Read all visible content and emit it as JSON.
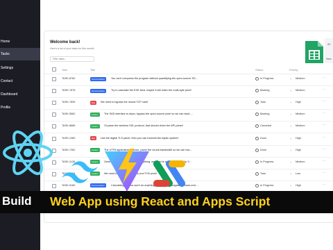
{
  "sidebar": {
    "items": [
      {
        "label": "Home"
      },
      {
        "label": "Tasks"
      },
      {
        "label": "Settings"
      },
      {
        "label": "Contact"
      },
      {
        "label": "Dashboard"
      },
      {
        "label": "Profile"
      }
    ],
    "active_index": 1
  },
  "header": {
    "title": "Welcome back!",
    "subtitle": "Here's a list of your tasks for this month!"
  },
  "filter": {
    "placeholder": "Filter tasks..."
  },
  "table": {
    "columns": [
      "Task",
      "Title",
      "Status",
      "Priority"
    ],
    "rows": [
      {
        "task": "TASK-8782",
        "label": "Documentation",
        "title": "You can't compress the program without quantifying the open-source SS...",
        "status": "In Progress",
        "priority": "Medium"
      },
      {
        "task": "TASK-7878",
        "label": "Documentation",
        "title": "Try to calculate the EXE feed, maybe it will index the multi-byte pixel!",
        "status": "Backlog",
        "priority": "Medium"
      },
      {
        "task": "TASK-7839",
        "label": "Bug",
        "title": "We need to bypass the neural TCP card!",
        "status": "Todo",
        "priority": "High"
      },
      {
        "task": "TASK-5562",
        "label": "Feature",
        "title": "The SAS interface is down, bypass the open-source pixel so we can back ...",
        "status": "Backlog",
        "priority": "Medium"
      },
      {
        "task": "TASK-8686",
        "label": "Feature",
        "title": "I'll parse the wireless SSL protocol, that should driver the API panel!",
        "status": "Canceled",
        "priority": "Medium"
      },
      {
        "task": "TASK-1280",
        "label": "Bug",
        "title": "Use the digital TLS panel, then you can transmit the haptic system!",
        "status": "Done",
        "priority": "High"
      },
      {
        "task": "TASK-7262",
        "label": "Feature",
        "title": "The UTF8 application is down, parse the neural bandwidth so we can bac...",
        "status": "Done",
        "priority": "High"
      },
      {
        "task": "TASK-1138",
        "label": "Feature",
        "title": "Generating the driver won't do anything, we need to quantify the 1080p S...",
        "status": "In Progress",
        "priority": "Medium"
      },
      {
        "task": "TASK-7184",
        "label": "Feature",
        "title": "We need to program the back-end THX pixel!",
        "status": "Todo",
        "priority": "Low"
      },
      {
        "task": "TASK-5160",
        "label": "Documentation",
        "title": "Calculating the bus won't do anything, we need to navigate the back-end ...",
        "status": "In Progress",
        "priority": "High"
      }
    ]
  },
  "label_colors": {
    "Documentation": "#2f6bf0",
    "Bug": "#e5484d",
    "Feature": "#2fae5a"
  },
  "sheets": {
    "side_top": "SC",
    "side_bottom": "View"
  },
  "banner": {
    "left": "Build",
    "right": "Web App using React and Apps Script"
  }
}
